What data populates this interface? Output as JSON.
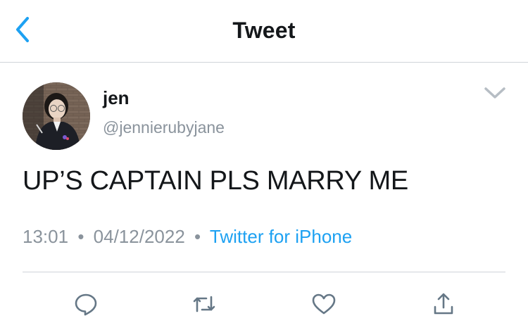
{
  "header": {
    "title": "Tweet"
  },
  "icons": {
    "back": "chevron-left-icon",
    "more": "chevron-down-icon",
    "reply": "reply-icon",
    "retweet": "retweet-icon",
    "like": "heart-icon",
    "share": "share-icon"
  },
  "colors": {
    "accent": "#1da1f2",
    "text_primary": "#14171a",
    "text_secondary": "#8a939c",
    "divider": "#cfd4d9"
  },
  "tweet": {
    "author": {
      "name": "jen",
      "handle": "@jennierubyjane"
    },
    "text": "UP’S CAPTAIN PLS MARRY ME",
    "time": "13:01",
    "separator": "•",
    "date": "04/12/2022",
    "source": "Twitter for iPhone"
  }
}
